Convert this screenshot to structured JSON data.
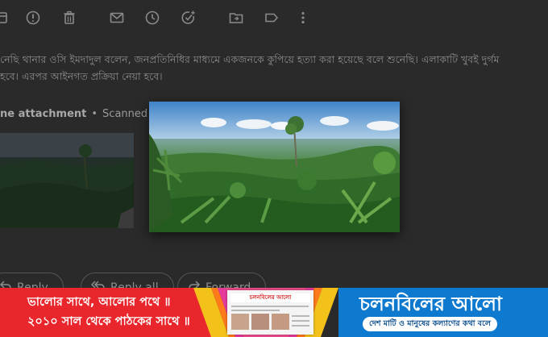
{
  "toolbar": {
    "icons": [
      "archive-icon",
      "report-spam-icon",
      "delete-icon",
      "mark-unread-icon",
      "snooze-icon",
      "add-to-tasks-icon",
      "move-to-icon",
      "label-icon",
      "more-options-icon"
    ]
  },
  "email": {
    "body_line1": "নেছি থানার ওসি ইমদাদুল বলেন, জনপ্রতিনিধির মাধ্যমে একজনকে কুপিয়ে হত্যা করা হয়েছে বলে শুনেছি। এলাকাটি খুবই দুর্গম",
    "body_line2": "হবে। এরপর আইনগত প্রক্রিয়া নেয়া হবে।",
    "attachment_count": "ne attachment",
    "attachment_separator": "•",
    "attachment_status": "Scanned b",
    "reply_label": "Reply",
    "reply_all_label": "Reply all",
    "forward_label": "Forward"
  },
  "banner": {
    "left_line1": "ভালোর সাথে, আলোর পথে ॥",
    "left_line2": "২০১০ সাল থেকে পাঠকের সাথে ॥",
    "paper_masthead": "চলনবিলের আলো",
    "brand": "চলনবিলের আলো",
    "tagline": "দেশ মাটি ও মানুষের কল্যাণের কথা বলে",
    "colors": {
      "left_bg": "#e8262b",
      "right_bg": "#0d7ad0"
    }
  }
}
